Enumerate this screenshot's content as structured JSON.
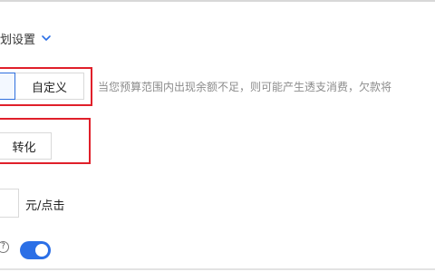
{
  "settings": {
    "section_label": "划设置",
    "custom_label": "自定义",
    "hint_text": "当您预算范围内出现余额不足，则可能产生透支消费，欠款将",
    "convert_label": "转化",
    "price_unit": "元/点击",
    "help_symbol": "?",
    "toggle_state": "on"
  },
  "colors": {
    "accent": "#2b6fe6",
    "highlight_border": "#e0202a",
    "hint_text": "#8c8c8c"
  },
  "icons": {
    "expand": "chevron-down-icon",
    "help": "help-circle-icon"
  }
}
